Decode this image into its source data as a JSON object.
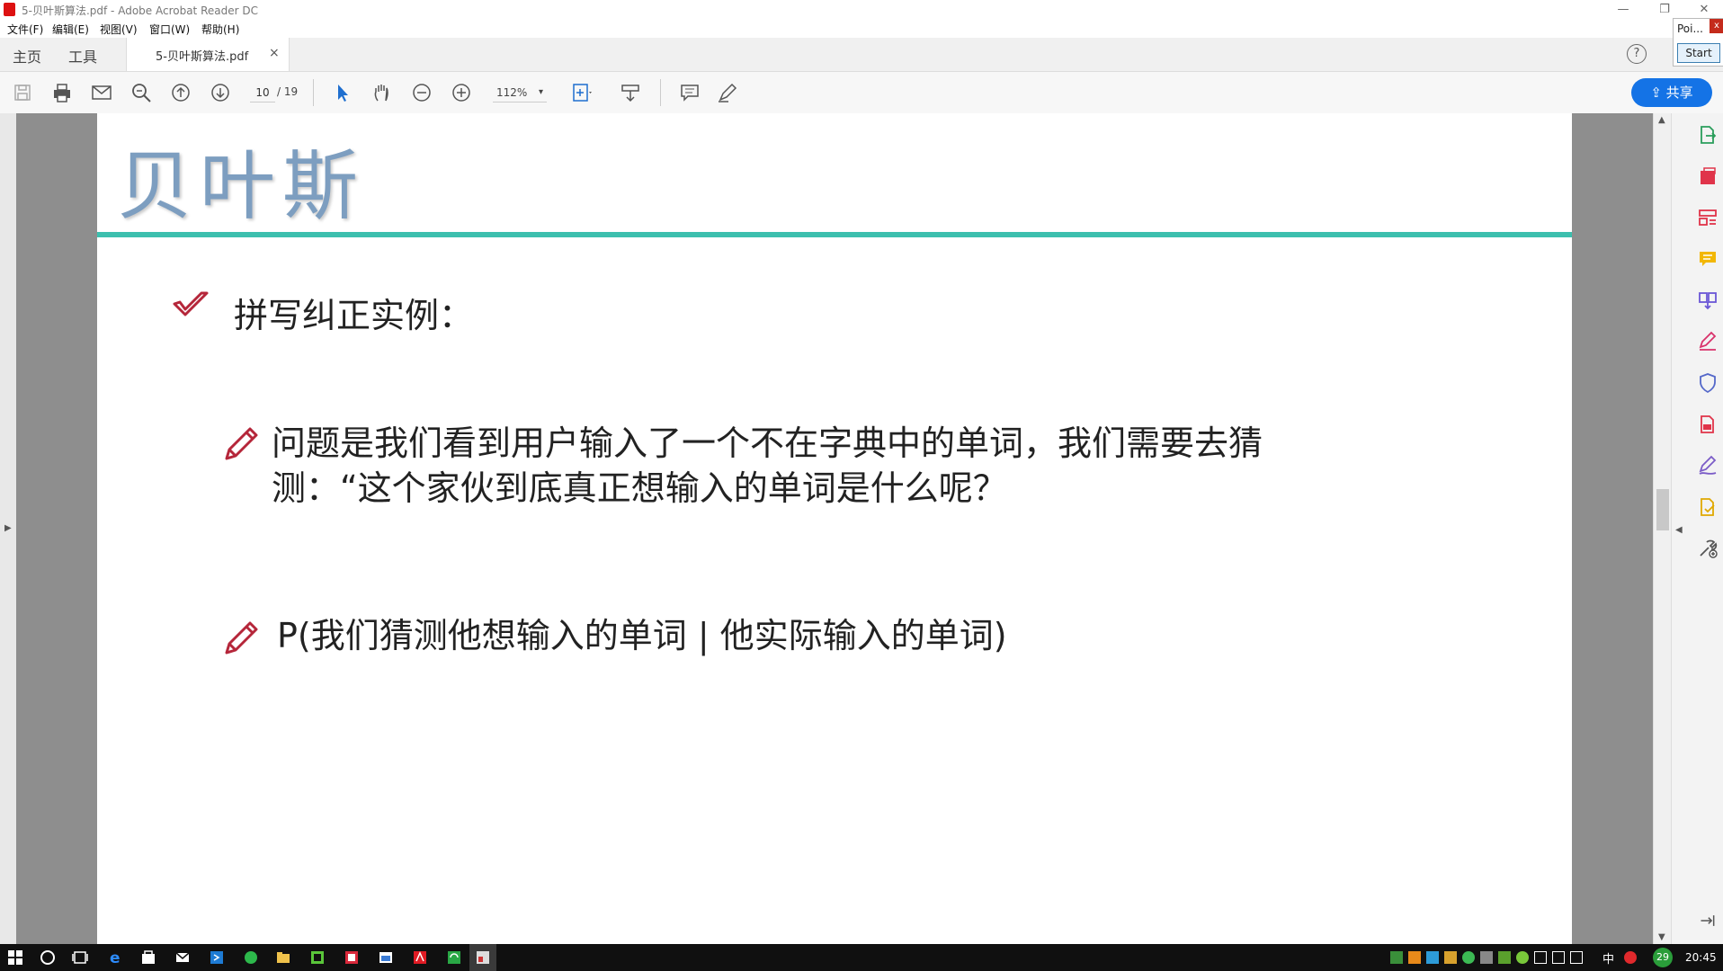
{
  "window": {
    "title": "5-贝叶斯算法.pdf - Adobe Acrobat Reader DC",
    "minimize": "—",
    "restore": "❐",
    "close": "✕"
  },
  "menu": [
    "文件(F)",
    "编辑(E)",
    "视图(V)",
    "窗口(W)",
    "帮助(H)"
  ],
  "tabs": {
    "home": "主页",
    "tools": "工具",
    "document": "5-贝叶斯算法.pdf",
    "close": "×",
    "help": "?"
  },
  "toolbar": {
    "page_current": "10",
    "page_total": "/ 19",
    "zoom": "112%",
    "zoom_caret": "▾",
    "share": "共享",
    "icons": [
      "save-icon",
      "print-icon",
      "email-icon",
      "zoom-search-icon",
      "page-up-icon",
      "page-down-icon",
      "select-arrow-icon",
      "hand-icon",
      "zoom-out-icon",
      "zoom-in-icon",
      "fit-page-icon",
      "scroll-mode-icon",
      "comment-icon",
      "pen-icon"
    ]
  },
  "slide": {
    "title": "贝叶斯",
    "heading": "拼写纠正实例：",
    "bullet1_line1": "问题是我们看到用户输入了一个不在字典中的单词，我们需要去猜",
    "bullet1_line2": "测：“这个家伙到底真正想输入的单词是什么呢？",
    "bullet2": "P(我们猜测他想输入的单词 | 他实际输入的单词)",
    "colors": {
      "title": "#7d9ec0",
      "rule": "#3cbfae",
      "bullet": "#b5263a"
    }
  },
  "right_tools": [
    "export-pdf-icon",
    "create-pdf-icon",
    "organize-pages-icon",
    "comment-icon",
    "combine-files-icon",
    "fill-sign-icon",
    "protect-icon",
    "edit-pdf-icon",
    "sign-icon",
    "send-for-review-icon",
    "more-tools-icon"
  ],
  "popup": {
    "label": "Poi...",
    "close": "x",
    "start": "Start"
  },
  "taskbar": {
    "ime": "中",
    "badge": "29",
    "time": "20:45"
  }
}
